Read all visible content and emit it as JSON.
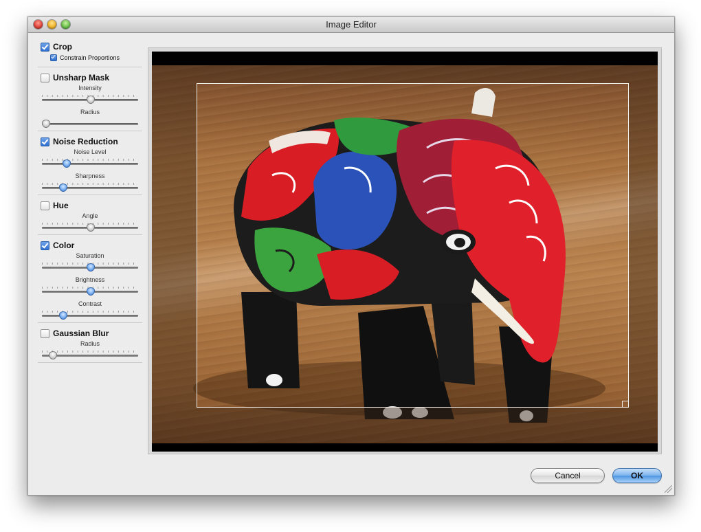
{
  "window": {
    "title": "Image Editor"
  },
  "sidebar": {
    "crop": {
      "label": "Crop",
      "checked": true,
      "constrain_label": "Constrain Proportions",
      "constrain_checked": true
    },
    "unsharp_mask": {
      "label": "Unsharp Mask",
      "checked": false,
      "params": [
        {
          "label": "Intensity",
          "value": 0.5
        },
        {
          "label": "Radius",
          "value": 0.05
        }
      ]
    },
    "noise_reduction": {
      "label": "Noise Reduction",
      "checked": true,
      "params": [
        {
          "label": "Noise Level",
          "value": 0.26
        },
        {
          "label": "Sharpness",
          "value": 0.22
        }
      ]
    },
    "hue": {
      "label": "Hue",
      "checked": false,
      "params": [
        {
          "label": "Angle",
          "value": 0.5
        }
      ]
    },
    "color": {
      "label": "Color",
      "checked": true,
      "params": [
        {
          "label": "Saturation",
          "value": 0.5
        },
        {
          "label": "Brightness",
          "value": 0.5
        },
        {
          "label": "Contrast",
          "value": 0.22
        }
      ]
    },
    "gaussian_blur": {
      "label": "Gaussian Blur",
      "checked": false,
      "params": [
        {
          "label": "Radius",
          "value": 0.12
        }
      ]
    }
  },
  "buttons": {
    "cancel": "Cancel",
    "ok": "OK"
  },
  "colors": {
    "accent": "#3f84e5",
    "window_bg": "#ececec"
  }
}
